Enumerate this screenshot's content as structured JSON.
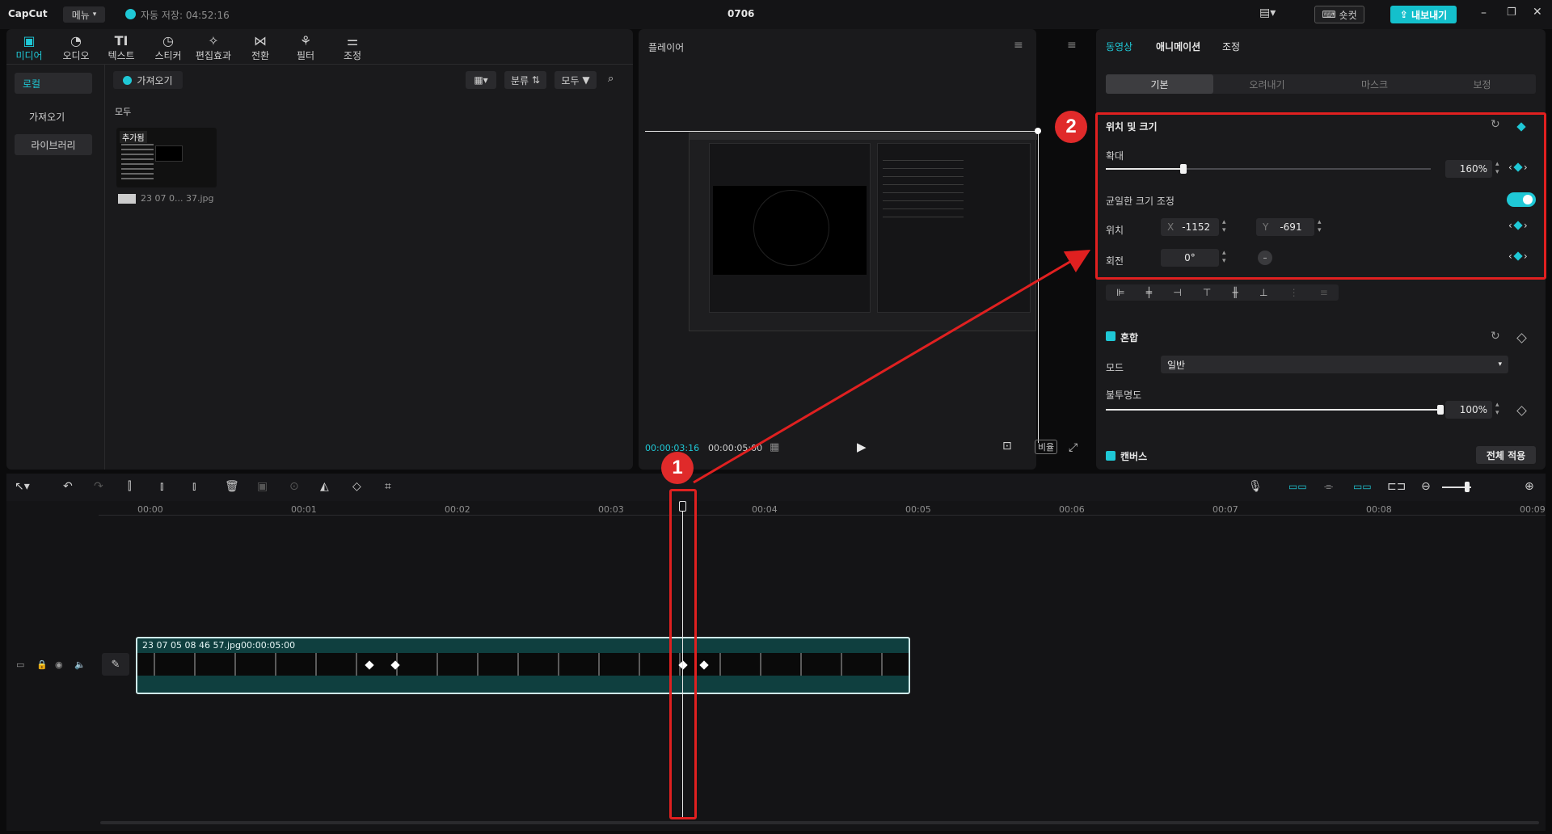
{
  "app": {
    "logo": "CapCut",
    "menu": "메뉴",
    "autosave": "자동 저장: 04:52:16",
    "project": "0706",
    "shortcut": "숏컷",
    "export": "내보내기"
  },
  "toolbar": {
    "tabs": [
      {
        "label": "미디어",
        "icon": "media-icon"
      },
      {
        "label": "오디오",
        "icon": "audio-icon"
      },
      {
        "label": "텍스트",
        "icon": "text-icon"
      },
      {
        "label": "스티커",
        "icon": "sticker-icon"
      },
      {
        "label": "편집효과",
        "icon": "effects-icon"
      },
      {
        "label": "전환",
        "icon": "transition-icon"
      },
      {
        "label": "필터",
        "icon": "filter-icon"
      },
      {
        "label": "조정",
        "icon": "adjust-icon"
      }
    ]
  },
  "media": {
    "sidebar": {
      "local": "로컬",
      "import": "가져오기",
      "library": "라이브러리"
    },
    "import_btn": "가져오기",
    "sort": "분류",
    "filter": "모두",
    "section": "모두",
    "thumb_badge": "추가됨",
    "file_name": "23 07 0... 37.jpg"
  },
  "player": {
    "title": "플레이어",
    "current_time": "00:00:03:16",
    "total_time": "00:00:05:00",
    "ratio": "비율"
  },
  "inspector": {
    "tabs": [
      "동영상",
      "애니메이션",
      "조정"
    ],
    "subtabs": [
      "기본",
      "오려내기",
      "마스크",
      "보정"
    ],
    "section_title": "위치 및 크기",
    "scale_label": "확대",
    "scale_value": "160%",
    "scale_level": 0.24,
    "uniform_label": "균일한 크기 조정",
    "position_label": "위치",
    "x_label": "X",
    "x_value": "-1152",
    "y_label": "Y",
    "y_value": "-691",
    "rotation_label": "회전",
    "rotation_value": "0°",
    "blend_title": "혼합",
    "mode_label": "모드",
    "mode_value": "일반",
    "opacity_label": "불투명도",
    "opacity_value": "100%",
    "canvas_title": "캔버스",
    "apply_all": "전체 적용"
  },
  "timeline": {
    "ruler": [
      "00:00",
      "00:01",
      "00:02",
      "00:03",
      "00:04",
      "00:05",
      "00:06",
      "00:07",
      "00:08",
      "00:09"
    ],
    "clip_name": "23 07 05 08 46 57.jpg",
    "clip_duration": "00:00:05:00"
  },
  "annotations": {
    "badge1": "1",
    "badge2": "2"
  },
  "colors": {
    "accent": "#1fc8d6",
    "annotation": "#e02020"
  }
}
